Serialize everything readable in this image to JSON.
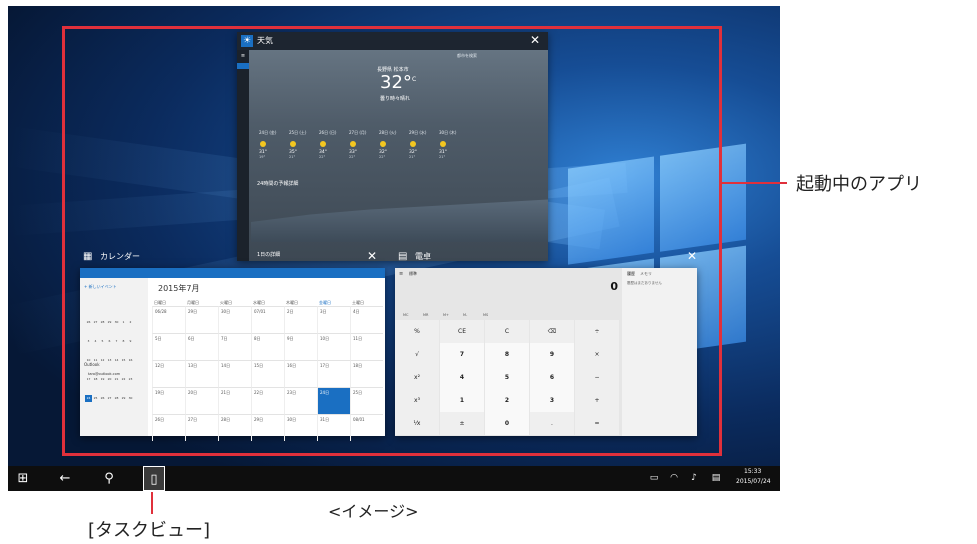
{
  "annotations": {
    "running_apps_label": "起動中のアプリ",
    "image_label": "<イメージ>",
    "task_view_label": "[タスクビュー]"
  },
  "weather_app": {
    "title": "天気",
    "location": "長野県 松本市",
    "temperature": "32°",
    "unit": "C",
    "condition": "曇り時々晴れ",
    "search_placeholder": "都市を検索",
    "hourly_title": "24時間の予報詳細",
    "footer": "1日の詳細",
    "days": [
      {
        "day": "24日 (金)",
        "high": "31°",
        "low": "19°"
      },
      {
        "day": "25日 (土)",
        "high": "35°",
        "low": "21°"
      },
      {
        "day": "26日 (日)",
        "high": "34°",
        "low": "22°"
      },
      {
        "day": "27日 (月)",
        "high": "33°",
        "low": "22°"
      },
      {
        "day": "28日 (火)",
        "high": "32°",
        "low": "22°"
      },
      {
        "day": "29日 (水)",
        "high": "32°",
        "low": "21°"
      },
      {
        "day": "30日 (木)",
        "high": "31°",
        "low": "21°"
      }
    ]
  },
  "calendar_app": {
    "title": "カレンダー",
    "new_event": "+ 新しいイベント",
    "month_title": "2015年7月",
    "outlook_label": "Outlook",
    "account": "taro@outlook.com",
    "weekdays": [
      "日曜日",
      "月曜日",
      "火曜日",
      "水曜日",
      "木曜日",
      "金曜日",
      "土曜日"
    ],
    "weeks": [
      [
        "06/28",
        "29日",
        "30日",
        "07/01",
        "2日",
        "3日",
        "4日"
      ],
      [
        "5日",
        "6日",
        "7日",
        "8日",
        "9日",
        "10日",
        "11日"
      ],
      [
        "12日",
        "13日",
        "14日",
        "15日",
        "16日",
        "17日",
        "18日"
      ],
      [
        "19日",
        "20日",
        "21日",
        "22日",
        "23日",
        "24日",
        "25日"
      ],
      [
        "26日",
        "27日",
        "28日",
        "29日",
        "30日",
        "31日",
        "08/01"
      ]
    ]
  },
  "calculator_app": {
    "title": "電卓",
    "mode": "標準",
    "display": "0",
    "history_tab": "履歴",
    "memory_tab": "メモリ",
    "history_empty": "履歴はまだありません",
    "memory_row": [
      "MC",
      "MR",
      "M+",
      "M-",
      "MS"
    ],
    "keys": [
      [
        "%",
        "CE",
        "C",
        "⌫",
        "÷"
      ],
      [
        "√",
        "7",
        "8",
        "9",
        "×"
      ],
      [
        "x²",
        "4",
        "5",
        "6",
        "−"
      ],
      [
        "x³",
        "1",
        "2",
        "3",
        "+"
      ],
      [
        "¹⁄x",
        "±",
        "0",
        ".",
        "="
      ]
    ]
  },
  "taskbar": {
    "time": "15:33",
    "date": "2015/07/24"
  },
  "colors": {
    "frame": "#e0303b",
    "accent": "#1a6fc2",
    "taskbar": "#0e0e0e"
  }
}
